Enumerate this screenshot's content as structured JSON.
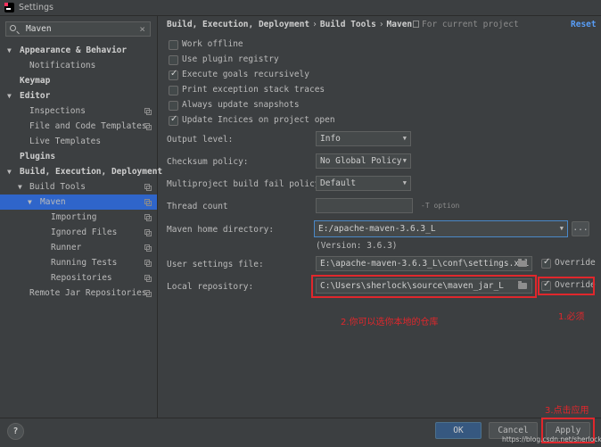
{
  "window": {
    "title": "Settings"
  },
  "search": {
    "value": "Maven",
    "clear": "×"
  },
  "tree": [
    {
      "label": "Appearance & Behavior",
      "bold": true,
      "arrow": "▼",
      "indent": 0,
      "copy": false
    },
    {
      "label": "Notifications",
      "bold": false,
      "arrow": "",
      "indent": 1,
      "copy": false
    },
    {
      "label": "Keymap",
      "bold": true,
      "arrow": "",
      "indent": 0,
      "copy": false
    },
    {
      "label": "Editor",
      "bold": true,
      "arrow": "▼",
      "indent": 0,
      "copy": false
    },
    {
      "label": "Inspections",
      "bold": false,
      "arrow": "",
      "indent": 1,
      "copy": true
    },
    {
      "label": "File and Code Templates",
      "bold": false,
      "arrow": "",
      "indent": 1,
      "copy": true
    },
    {
      "label": "Live Templates",
      "bold": false,
      "arrow": "",
      "indent": 1,
      "copy": false
    },
    {
      "label": "Plugins",
      "bold": true,
      "arrow": "",
      "indent": 0,
      "copy": false
    },
    {
      "label": "Build, Execution, Deployment",
      "bold": true,
      "arrow": "▼",
      "indent": 0,
      "copy": false
    },
    {
      "label": "Build Tools",
      "bold": false,
      "arrow": "▼",
      "indent": 1,
      "copy": true
    },
    {
      "label": "Maven",
      "bold": false,
      "arrow": "▼",
      "indent": 2,
      "copy": true,
      "selected": true
    },
    {
      "label": "Importing",
      "bold": false,
      "arrow": "",
      "indent": 3,
      "copy": true
    },
    {
      "label": "Ignored Files",
      "bold": false,
      "arrow": "",
      "indent": 3,
      "copy": true
    },
    {
      "label": "Runner",
      "bold": false,
      "arrow": "",
      "indent": 3,
      "copy": true
    },
    {
      "label": "Running Tests",
      "bold": false,
      "arrow": "",
      "indent": 3,
      "copy": true
    },
    {
      "label": "Repositories",
      "bold": false,
      "arrow": "",
      "indent": 3,
      "copy": true
    },
    {
      "label": "Remote Jar Repositories",
      "bold": false,
      "arrow": "",
      "indent": 1,
      "copy": true
    }
  ],
  "breadcrumb": {
    "part1": "Build, Execution, Deployment",
    "part2": "Build Tools",
    "part3": "Maven",
    "sep": "›"
  },
  "for_current_project": "For current project",
  "reset": "Reset",
  "checkboxes": [
    {
      "label": "Work offline",
      "checked": false
    },
    {
      "label": "Use plugin registry",
      "checked": false
    },
    {
      "label": "Execute goals recursively",
      "checked": true
    },
    {
      "label": "Print exception stack traces",
      "checked": false
    },
    {
      "label": "Always update snapshots",
      "checked": false
    },
    {
      "label": "Update Incices on project open",
      "checked": true
    }
  ],
  "fields": {
    "output_level": {
      "label": "Output level:",
      "value": "Info"
    },
    "checksum_policy": {
      "label": "Checksum policy:",
      "value": "No Global Policy"
    },
    "multiproject_fail": {
      "label": "Multiproject build fail policy:",
      "value": "Default"
    },
    "thread_count": {
      "label": "Thread count",
      "value": "",
      "hint": "-T option"
    },
    "maven_home": {
      "label": "Maven home directory:",
      "value": "E:/apache-maven-3.6.3_L",
      "version": "(Version: 3.6.3)",
      "browse": "..."
    },
    "user_settings": {
      "label": "User settings file:",
      "value": "E:\\apache-maven-3.6.3_L\\conf\\settings.xml",
      "override_label": "Override",
      "override_checked": true
    },
    "local_repo": {
      "label": "Local repository:",
      "value": "C:\\Users\\sherlock\\source\\maven_jar_L",
      "override_label": "Override",
      "override_checked": true
    }
  },
  "annotations": {
    "a1": "1.必须",
    "a2": "2.你可以选你本地的仓库",
    "a3": "3.点击应用"
  },
  "buttons": {
    "ok": "OK",
    "cancel": "Cancel",
    "apply": "Apply",
    "help": "?"
  },
  "watermark": "https://blog.csdn.net/sherlockky",
  "colors": {
    "background": "#3c3f41",
    "selection": "#2f65ca",
    "link": "#589df6",
    "annotation": "#e0272c",
    "default_button": "#365880"
  }
}
